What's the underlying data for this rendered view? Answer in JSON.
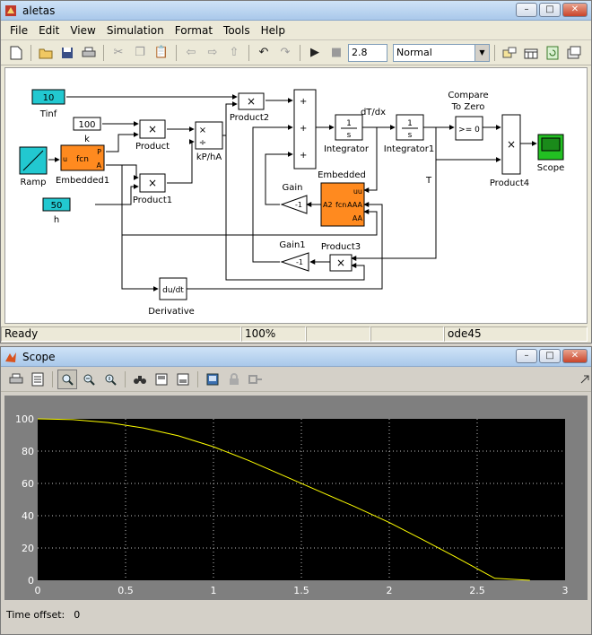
{
  "model_window": {
    "title": "aletas",
    "menu": [
      "File",
      "Edit",
      "View",
      "Simulation",
      "Format",
      "Tools",
      "Help"
    ],
    "stop_time": "2.8",
    "sim_mode": "Normal",
    "status": [
      "Ready",
      "100%",
      "",
      "",
      "ode45"
    ],
    "blocks": {
      "tinf_value": "10",
      "tinf_label": "Tinf",
      "k_value": "100",
      "k_label": "k",
      "h_value": "50",
      "h_label": "h",
      "ramp_label": "Ramp",
      "emb1_fcn": "fcn",
      "emb1_u": "u",
      "emb1_p": "P",
      "emb1_a": "A",
      "emb1_label": "Embedded1",
      "product_label": "Product",
      "product1_label": "Product1",
      "product2_label": "Product2",
      "product3_label": "Product3",
      "product4_label": "Product4",
      "kpha_label": "kP/hA",
      "mult_sym": "×",
      "div_sym": "÷",
      "plus": "+",
      "int_num": "1",
      "int_den": "s",
      "integrator_label": "Integrator",
      "integrator1_label": "Integrator1",
      "dtdx_label": "dT/dx",
      "t_label": "T",
      "compare_label1": "Compare",
      "compare_label2": "To Zero",
      "compare_text": ">= 0",
      "scope_label": "Scope",
      "embedded_label": "Embedded",
      "emb_a2": "A2",
      "emb_fcn": "fcn",
      "emb_uu": "uu",
      "emb_aaa": "AAA",
      "emb_aa": "AA",
      "gain_label": "Gain",
      "gain1_label": "Gain1",
      "gain_value": "-1",
      "derivative_text": "du/dt",
      "derivative_label": "Derivative"
    }
  },
  "scope_window": {
    "title": "Scope",
    "time_offset_label": "Time offset:",
    "time_offset_value": "0"
  },
  "chart_data": {
    "type": "line",
    "title": "",
    "xlabel": "",
    "ylabel": "",
    "xlim": [
      0,
      3
    ],
    "ylim": [
      0,
      100
    ],
    "xticks": [
      "0",
      "0.5",
      "1",
      "1.5",
      "2",
      "2.5",
      "3"
    ],
    "yticks": [
      "0",
      "20",
      "40",
      "60",
      "80",
      "100"
    ],
    "grid": true,
    "background": "#000000",
    "line_color": "#ffff00",
    "series": [
      {
        "x": [
          0,
          0.2,
          0.4,
          0.6,
          0.8,
          1.0,
          1.2,
          1.4,
          1.6,
          1.8,
          2.0,
          2.2,
          2.4,
          2.6,
          2.8
        ],
        "values": [
          100,
          99.5,
          97.7,
          94.4,
          89.5,
          82.7,
          74.2,
          64.8,
          55.2,
          45.8,
          35.8,
          24.6,
          13.1,
          1.2,
          0
        ]
      }
    ]
  }
}
